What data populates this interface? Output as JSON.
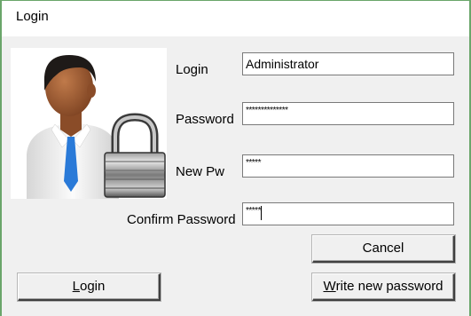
{
  "window": {
    "title": "Login"
  },
  "avatar": {
    "icon": "user-lock-icon"
  },
  "form": {
    "login_label": "Login",
    "login_value": "Administrator",
    "password_label": "Password",
    "password_value": "**************",
    "new_pw_label": "New Pw",
    "new_pw_value": "*****",
    "confirm_label": "Confirm Password",
    "confirm_value": "*****"
  },
  "buttons": {
    "cancel": "Cancel",
    "login_first": "L",
    "login_rest": "ogin",
    "write_first": "W",
    "write_rest": "rite new password"
  },
  "colors": {
    "window_border": "#6aa56a",
    "background": "#f0f0f0"
  }
}
